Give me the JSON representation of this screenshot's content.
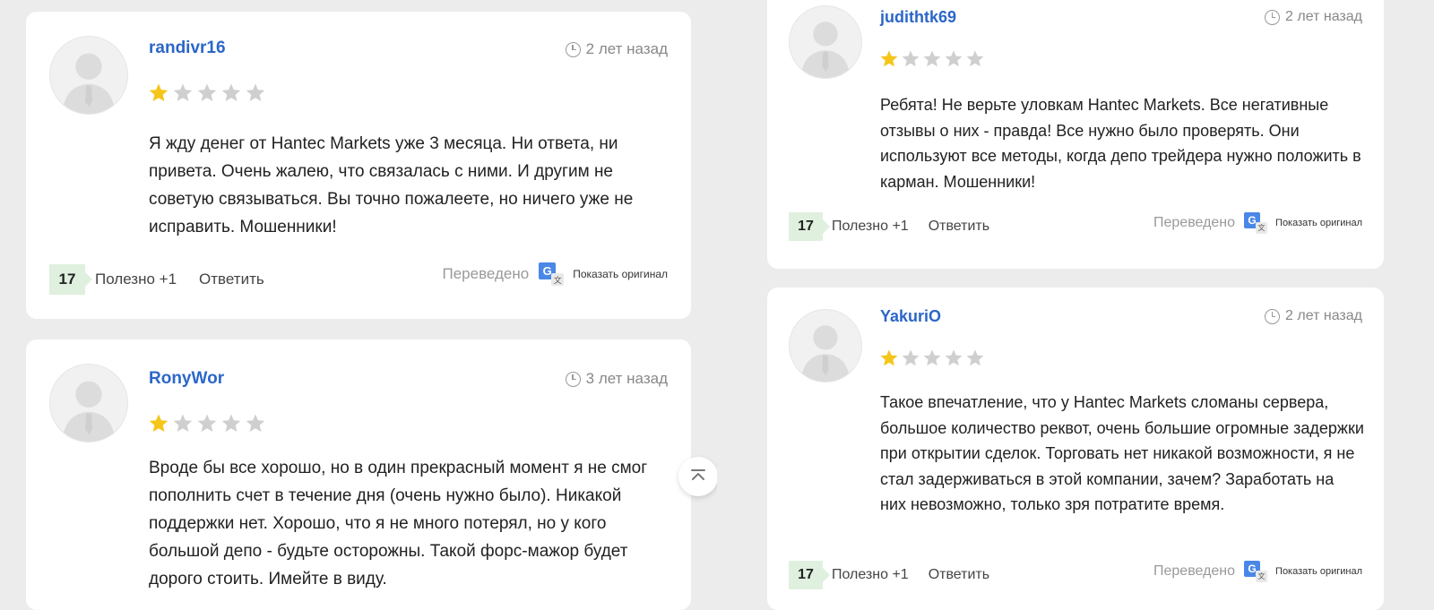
{
  "reviews": [
    {
      "username": "randivr16",
      "time": "2 лет назад",
      "rating": 1,
      "text": "Я жду денег от Hantec Markets уже 3 месяца. Ни ответа, ни привета. Очень жалею, что связалась с ними. И другим не советую связываться. Вы точно пожалеете, но ничего уже не исправить. Мошенники!",
      "count": "17",
      "useful": "Полезно +1",
      "reply": "Ответить",
      "translated": "Переведено",
      "show_original": "Показать оригинал"
    },
    {
      "username": "RonyWor",
      "time": "3 лет назад",
      "rating": 1,
      "text": "Вроде бы все хорошо, но в один прекрасный момент я не смог пополнить счет в течение дня (очень нужно было). Никакой поддержки нет. Хорошо, что я не много потерял, но у кого большой депо - будьте осторожны. Такой форс-мажор будет дорого стоить. Имейте в виду."
    },
    {
      "username": "judithtk69",
      "time": "2 лет назад",
      "rating": 1,
      "text": "Ребята! Не верьте уловкам Hantec Markets. Все негативные отзывы о них - правда! Все нужно было проверять. Они используют все методы, когда депо трейдера нужно положить в карман. Мошенники!",
      "count": "17",
      "useful": "Полезно +1",
      "reply": "Ответить",
      "translated": "Переведено",
      "show_original": "Показать оригинал"
    },
    {
      "username": "YakuriO",
      "time": "2 лет назад",
      "rating": 1,
      "text": "Такое впечатление, что у Hantec Markets сломаны сервера, большое количество реквот, очень большие огромные задержки при открытии сделок. Торговать нет никакой возможности, я не стал задерживаться в этой компании, зачем? Заработать на них невозможно, только зря потратите время.",
      "count": "17",
      "useful": "Полезно +1",
      "reply": "Ответить",
      "translated": "Переведено",
      "show_original": "Показать оригинал"
    }
  ],
  "max_rating": 5,
  "colors": {
    "star_filled": "#f5c518",
    "star_empty": "#cfcfcf",
    "username": "#2b66c9",
    "count_bg": "#dff0df"
  },
  "icons": {
    "clock": "clock-icon",
    "translate": "google-translate-icon",
    "scroll_top": "arrow-up-to-top-icon",
    "avatar": "default-user-avatar-icon"
  }
}
